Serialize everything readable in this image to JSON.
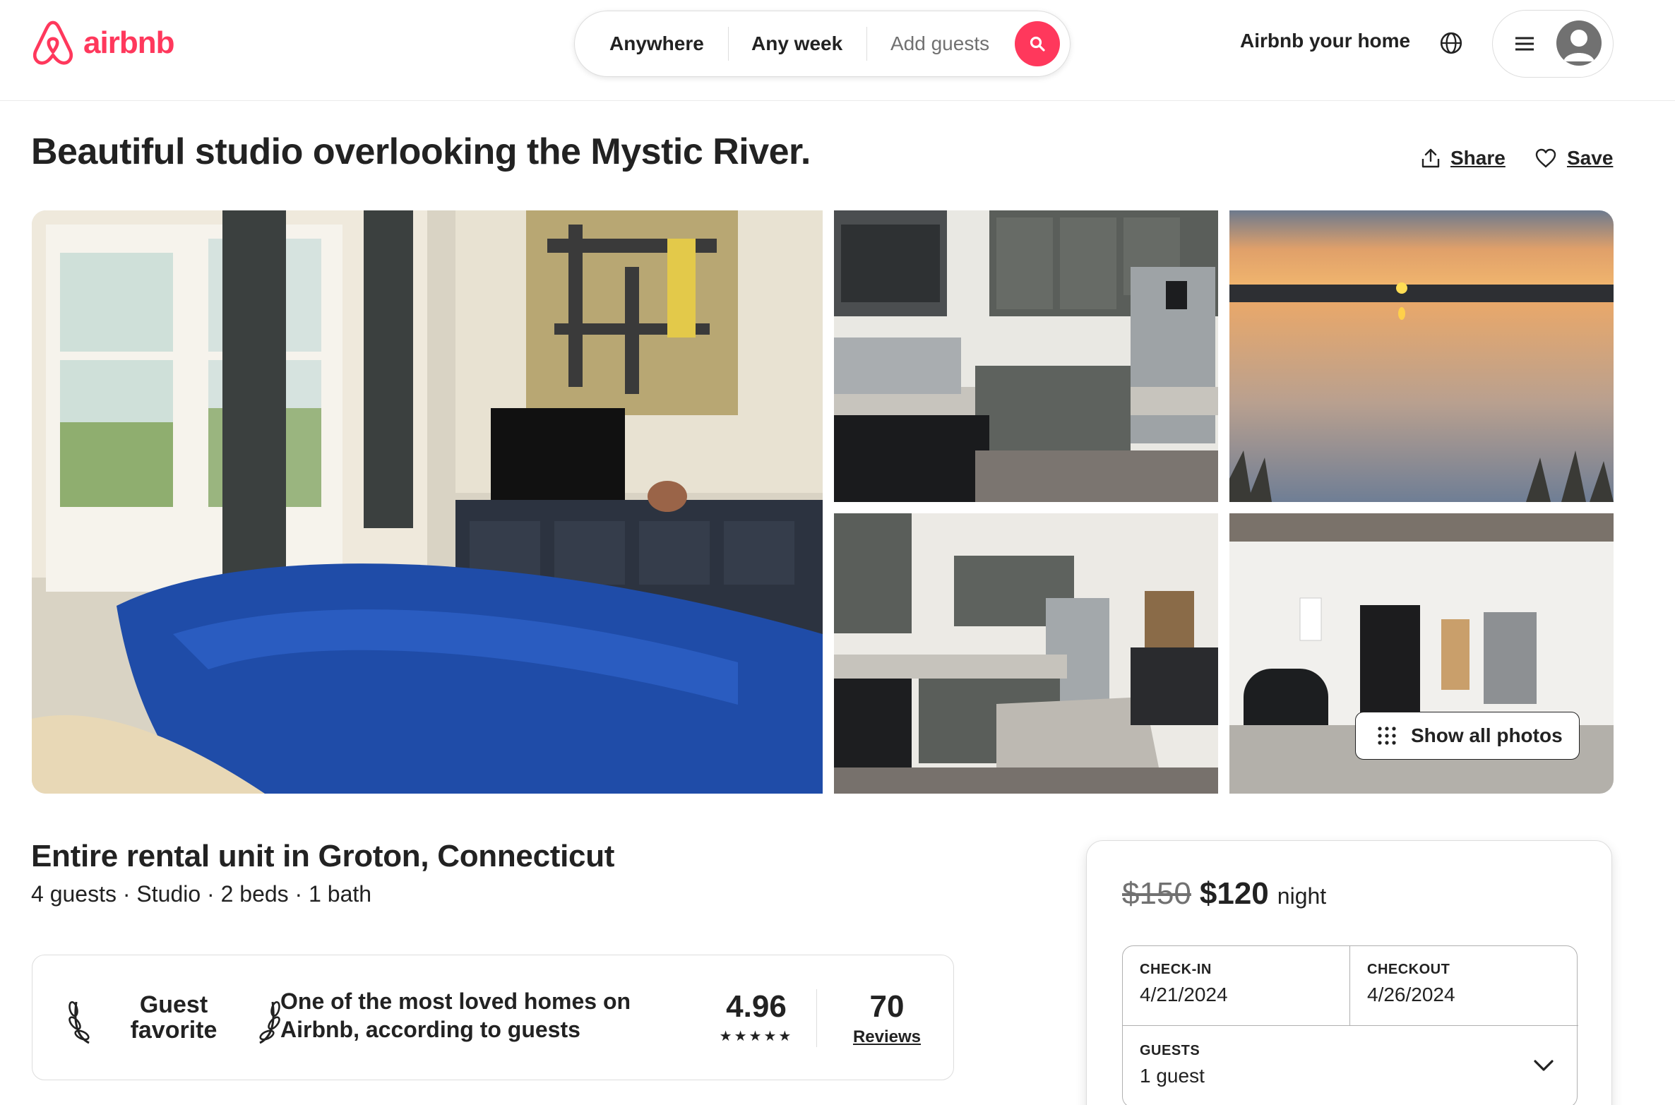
{
  "header": {
    "brand": "airbnb",
    "search": {
      "where": "Anywhere",
      "when": "Any week",
      "who_placeholder": "Add guests"
    },
    "host_link": "Airbnb your home",
    "brand_color": "#FF385C"
  },
  "listing": {
    "title": "Beautiful studio overlooking the Mystic River.",
    "actions": {
      "share": "Share",
      "save": "Save"
    },
    "photos": {
      "show_all": "Show all photos",
      "items": [
        "bedroom-photo",
        "kitchen-photo-1",
        "sunset-river-photo",
        "kitchen-photo-2",
        "coffee-station-photo"
      ]
    },
    "subtitle": "Entire rental unit in Groton, Connecticut",
    "summary": "4 guests · Studio · 2 beds · 1 bath",
    "guest_favorite": {
      "label_line1": "Guest",
      "label_line2": "favorite",
      "description_line1": "One of the most loved homes on",
      "description_line2": "Airbnb, according to guests",
      "rating": "4.96",
      "stars": "★★★★★",
      "reviews_count": "70",
      "reviews_label": "Reviews"
    }
  },
  "booking": {
    "original_price": "$150",
    "price": "$120",
    "unit": "night",
    "checkin_label": "CHECK-IN",
    "checkin_value": "4/21/2024",
    "checkout_label": "CHECKOUT",
    "checkout_value": "4/26/2024",
    "guests_label": "GUESTS",
    "guests_value": "1 guest"
  }
}
